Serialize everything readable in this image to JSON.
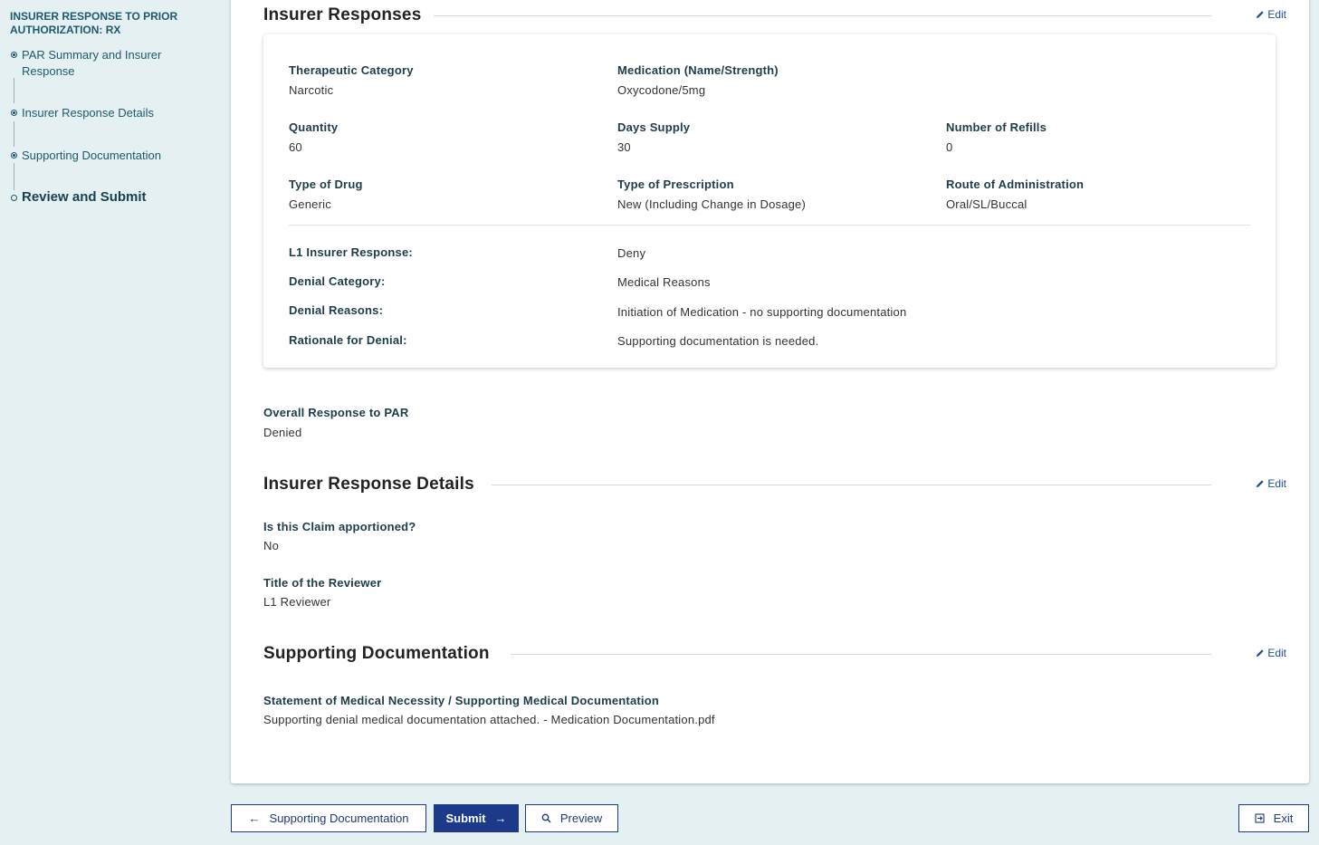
{
  "sidebar": {
    "title": "INSURER RESPONSE TO PRIOR AUTHORIZATION: RX",
    "items": [
      {
        "label": "PAR Summary and Insurer Response"
      },
      {
        "label": "Insurer Response Details"
      },
      {
        "label": "Supporting Documentation"
      },
      {
        "label": "Review and Submit"
      }
    ]
  },
  "edit_label": "Edit",
  "insurer_responses": {
    "title": "Insurer Responses",
    "fields": {
      "therapeutic_category": {
        "label": "Therapeutic Category",
        "value": "Narcotic"
      },
      "medication": {
        "label": "Medication (Name/Strength)",
        "value": "Oxycodone/5mg"
      },
      "quantity": {
        "label": "Quantity",
        "value": "60"
      },
      "days_supply": {
        "label": "Days Supply",
        "value": "30"
      },
      "refills": {
        "label": "Number of Refills",
        "value": "0"
      },
      "drug_type": {
        "label": "Type of Drug",
        "value": "Generic"
      },
      "prescription_type": {
        "label": "Type of Prescription",
        "value": "New (Including Change in Dosage)"
      },
      "route": {
        "label": "Route of Administration",
        "value": "Oral/SL/Buccal"
      }
    },
    "responses": {
      "l1": {
        "label": "L1 Insurer Response:",
        "value": "Deny"
      },
      "denial_category": {
        "label": "Denial Category:",
        "value": "Medical Reasons"
      },
      "denial_reasons": {
        "label": "Denial Reasons:",
        "value": "Initiation of Medication - no supporting documentation"
      },
      "rationale": {
        "label": "Rationale for Denial:",
        "value": "Supporting documentation is needed."
      }
    },
    "overall": {
      "label": "Overall Response to PAR",
      "value": "Denied"
    }
  },
  "response_details": {
    "title": "Insurer Response Details",
    "apportioned": {
      "label": "Is this Claim apportioned?",
      "value": "No"
    },
    "reviewer": {
      "label": "Title of the Reviewer",
      "value": "L1 Reviewer"
    }
  },
  "supporting_docs": {
    "title": "Supporting Documentation",
    "statement": {
      "label": "Statement of Medical Necessity / Supporting Medical Documentation",
      "value": "Supporting denial medical documentation attached. - Medication Documentation.pdf"
    }
  },
  "footer": {
    "back_label": "Supporting Documentation",
    "submit_label": "Submit",
    "preview_label": "Preview",
    "exit_label": "Exit"
  },
  "colors": {
    "background": "#e4f0f2",
    "primary": "#1d3a8a",
    "sidebar_text": "#1d5a6c"
  }
}
